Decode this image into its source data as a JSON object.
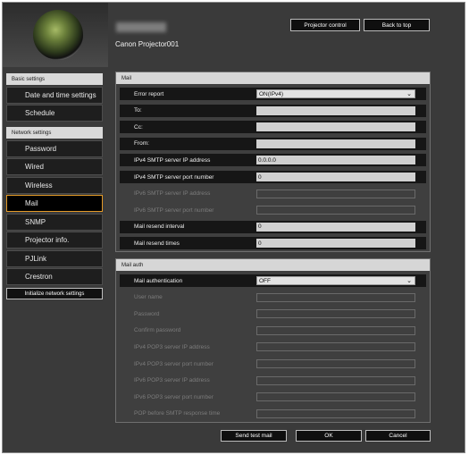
{
  "header": {
    "device_name": "Canon Projector001",
    "projector_control_label": "Projector control",
    "back_to_top_label": "Back to top"
  },
  "sidebar": {
    "basic_header": "Basic settings",
    "basic_items": [
      {
        "label": "Date and time settings"
      },
      {
        "label": "Schedule"
      }
    ],
    "network_header": "Network settings",
    "network_items": [
      {
        "label": "Password"
      },
      {
        "label": "Wired"
      },
      {
        "label": "Wireless"
      },
      {
        "label": "Mail"
      },
      {
        "label": "SNMP"
      },
      {
        "label": "Projector info."
      },
      {
        "label": "PJLink"
      },
      {
        "label": "Crestron"
      }
    ],
    "active_item": "Mail",
    "init_label": "Initialize network settings"
  },
  "mail": {
    "title": "Mail",
    "rows": [
      {
        "label": "Error report",
        "value": "ON(IPv4)",
        "type": "select",
        "enabled": true
      },
      {
        "label": "To:",
        "value": "",
        "type": "text",
        "enabled": true
      },
      {
        "label": "Cc:",
        "value": "",
        "type": "text",
        "enabled": true
      },
      {
        "label": "From:",
        "value": "",
        "type": "text",
        "enabled": true
      },
      {
        "label": "IPv4 SMTP server IP address",
        "value": "0.0.0.0",
        "type": "text",
        "enabled": true
      },
      {
        "label": "IPv4 SMTP server port number",
        "value": "0",
        "type": "text",
        "enabled": true
      },
      {
        "label": "IPv6 SMTP server IP address",
        "value": "",
        "type": "text",
        "enabled": false
      },
      {
        "label": "IPv6 SMTP server port number",
        "value": "",
        "type": "text",
        "enabled": false
      },
      {
        "label": "Mail resend interval",
        "value": "0",
        "type": "text",
        "enabled": true
      },
      {
        "label": "Mail resend times",
        "value": "0",
        "type": "text",
        "enabled": true
      }
    ]
  },
  "auth": {
    "title": "Mail auth",
    "rows": [
      {
        "label": "Mail authentication",
        "value": "OFF",
        "type": "select",
        "enabled": true
      },
      {
        "label": "User name",
        "value": "",
        "type": "text",
        "enabled": false
      },
      {
        "label": "Password",
        "value": "",
        "type": "text",
        "enabled": false
      },
      {
        "label": "Confirm password",
        "value": "",
        "type": "text",
        "enabled": false
      },
      {
        "label": "IPv4 POP3 server IP address",
        "value": "",
        "type": "text",
        "enabled": false
      },
      {
        "label": "IPv4 POP3 server port number",
        "value": "",
        "type": "text",
        "enabled": false
      },
      {
        "label": "IPv6 POP3 server IP address",
        "value": "",
        "type": "text",
        "enabled": false
      },
      {
        "label": "IPv6 POP3 server port number",
        "value": "",
        "type": "text",
        "enabled": false
      },
      {
        "label": "POP before SMTP response time",
        "value": "",
        "type": "text",
        "enabled": false
      }
    ]
  },
  "footer": {
    "send_test_label": "Send test mail",
    "ok_label": "OK",
    "cancel_label": "Cancel"
  }
}
